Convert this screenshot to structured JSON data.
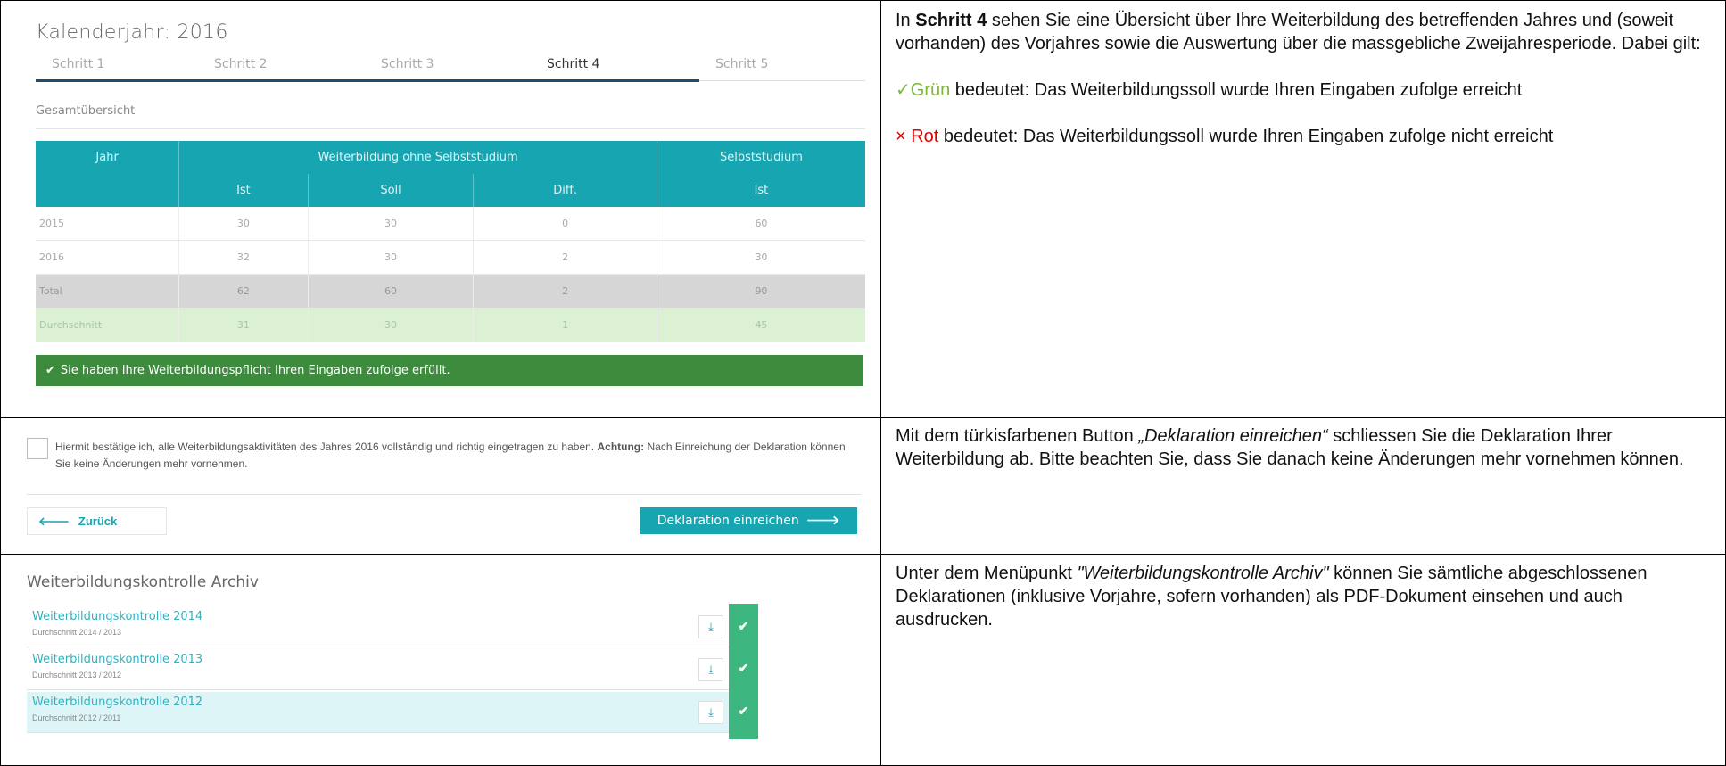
{
  "overview": {
    "calendar_title": "Kalenderjahr: 2016",
    "steps": [
      "Schritt 1",
      "Schritt 2",
      "Schritt 3",
      "Schritt 4",
      "Schritt 5"
    ],
    "active_step": "Schritt 4",
    "section_title": "Gesamtübersicht",
    "table": {
      "header_top": [
        "Jahr",
        "Weiterbildung ohne Selbststudium",
        "Selbststudium"
      ],
      "header_sub": [
        "Ist",
        "Soll",
        "Diff.",
        "Ist"
      ],
      "rows": [
        [
          "2015",
          "30",
          "30",
          "0",
          "60"
        ],
        [
          "2016",
          "32",
          "30",
          "2",
          "30"
        ],
        [
          "Total",
          "62",
          "60",
          "2",
          "90"
        ],
        [
          "Durchschnitt",
          "31",
          "30",
          "1",
          "45"
        ]
      ]
    },
    "success_message": "Sie haben Ihre Weiterbildungspflicht Ihren Eingaben zufolge erfüllt.",
    "colors": {
      "teal": "#17a5b2",
      "success": "#3d8b3c",
      "avg_row": "#dcf0d4",
      "total_row": "#d6d6d6"
    }
  },
  "declaration": {
    "confirm_text": "Hiermit bestätige ich, alle Weiterbildungsaktivitäten des Jahres 2016 vollständig und richtig eingetragen zu haben.",
    "confirm_bold": "Achtung:",
    "confirm_text_2": "Nach Einreichung der Deklaration können Sie keine Änderungen mehr vornehmen.",
    "back_label": "Zurück",
    "submit_label": "Deklaration einreichen"
  },
  "archive": {
    "title": "Weiterbildungskontrolle Archiv",
    "items": [
      {
        "name": "Weiterbildungskontrolle 2014",
        "sub": "Durchschnitt 2014 / 2013"
      },
      {
        "name": "Weiterbildungskontrolle 2013",
        "sub": "Durchschnitt 2013 / 2012"
      },
      {
        "name": "Weiterbildungskontrolle 2012",
        "sub": "Durchschnitt 2012 / 2011"
      }
    ]
  },
  "explanations": {
    "step4": {
      "pre": "In ",
      "bold": "Schritt 4",
      "post": " sehen Sie eine Übersicht über Ihre Weiterbildung des betreffenden Jahres und (soweit vorhanden) des Vorjahres sowie die Auswertung über die massgebliche Zweijahresperiode. Dabei gilt:",
      "green_mark": "✓Grün",
      "green_text": " bedeutet: Das Weiterbildungssoll wurde Ihren Eingaben zufolge erreicht",
      "red_mark": "× Rot",
      "red_text": " bedeutet: Das Weiterbildungssoll wurde Ihren Eingaben zufolge nicht erreicht"
    },
    "submit": {
      "pre": "Mit dem türkisfarbenen Button ",
      "italic": "„Deklaration einreichen“",
      "post": " schliessen Sie die Deklaration Ihrer Weiterbildung ab. Bitte beachten Sie, dass Sie danach keine Änderungen mehr vornehmen können."
    },
    "archive": {
      "pre": "Unter dem Menüpunkt ",
      "italic": "\"Weiterbildungskontrolle Archiv\"",
      "post": " können Sie sämtliche abgeschlossenen Deklarationen (inklusive Vorjahre, sofern vorhanden) als PDF-Dokument einsehen und auch ausdrucken."
    }
  },
  "icons": {
    "check": "✔",
    "arrow_left": "🡐",
    "arrow_right": "🡒",
    "download": "⤓"
  }
}
